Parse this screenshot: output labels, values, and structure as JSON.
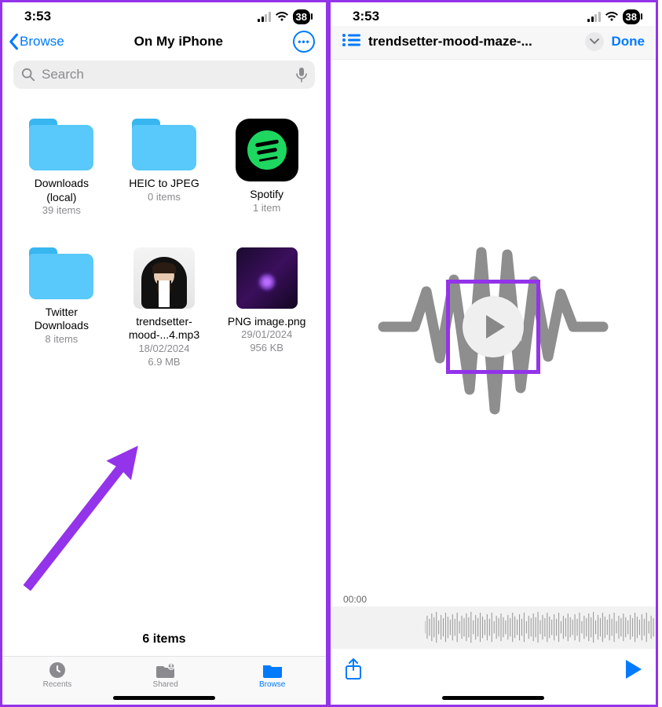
{
  "status": {
    "time": "3:53",
    "battery": "38"
  },
  "left": {
    "back": "Browse",
    "title": "On My iPhone",
    "search_placeholder": "Search",
    "items": [
      {
        "name": "Downloads (local)",
        "meta": "39 items",
        "type": "folder"
      },
      {
        "name": "HEIC to JPEG",
        "meta": "0 items",
        "type": "folder"
      },
      {
        "name": "Spotify",
        "meta": "1 item",
        "type": "app"
      },
      {
        "name": "Twitter Downloads",
        "meta": "8 items",
        "type": "folder"
      },
      {
        "name": "trendsetter-mood-...4.mp3",
        "date": "18/02/2024",
        "size": "6.9 MB",
        "type": "audio"
      },
      {
        "name": "PNG image.png",
        "date": "29/01/2024",
        "size": "956 KB",
        "type": "image"
      }
    ],
    "count": "6 items",
    "tabs": {
      "recents": "Recents",
      "shared": "Shared",
      "browse": "Browse"
    }
  },
  "right": {
    "title": "trendsetter-mood-maze-...",
    "done": "Done",
    "time": "00:00"
  }
}
